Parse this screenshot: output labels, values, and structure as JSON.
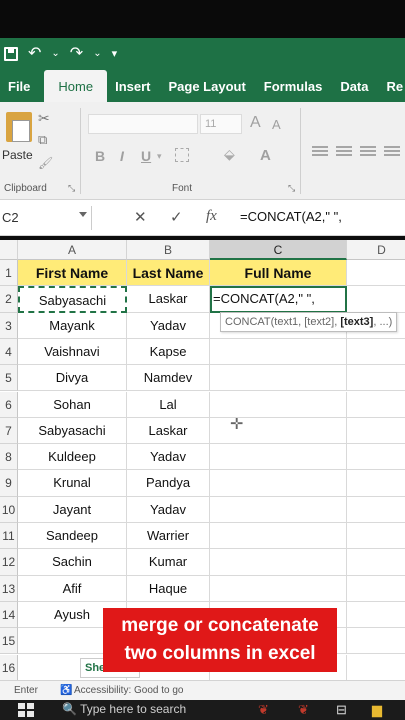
{
  "ribbon": {
    "tabs": [
      "File",
      "Home",
      "Insert",
      "Page Layout",
      "Formulas",
      "Data",
      "Re"
    ],
    "paste_label": "Paste",
    "clipboard_label": "Clipboard",
    "font_label": "Font",
    "font_size": "11",
    "bold": "B",
    "italic": "I",
    "underline": "U",
    "grow_font": "A",
    "shrink_font": "A",
    "font_color": "A"
  },
  "formula_bar": {
    "name_box": "C2",
    "cancel": "✕",
    "enter": "✓",
    "fx": "fx",
    "formula": "=CONCAT(A2,\" \","
  },
  "grid": {
    "columns": [
      "A",
      "B",
      "C",
      "D"
    ],
    "rows": [
      "1",
      "2",
      "3",
      "4",
      "5",
      "6",
      "7",
      "8",
      "9",
      "10",
      "11",
      "12",
      "13",
      "14",
      "15",
      "16"
    ],
    "header": [
      "First Name",
      "Last Name",
      "Full Name"
    ],
    "data": [
      [
        "Sabyasachi",
        "Laskar"
      ],
      [
        "Mayank",
        "Yadav"
      ],
      [
        "Vaishnavi",
        "Kapse"
      ],
      [
        "Divya",
        "Namdev"
      ],
      [
        "Sohan",
        "Lal"
      ],
      [
        "Sabyasachi",
        "Laskar"
      ],
      [
        "Kuldeep",
        "Yadav"
      ],
      [
        "Krunal",
        "Pandya"
      ],
      [
        "Jayant",
        "Yadav"
      ],
      [
        "Sandeep",
        "Warrier"
      ],
      [
        "Sachin",
        "Kumar"
      ],
      [
        "Afif",
        "Haque"
      ],
      [
        "Ayush",
        ""
      ]
    ],
    "active_cell_text": "=CONCAT(A2,\" \",",
    "tooltip_prefix": "CONCAT(text1, [text2], ",
    "tooltip_bold": "[text3]",
    "tooltip_suffix": ", ...)"
  },
  "caption": {
    "line1": "merge or concatenate",
    "line2": "two columns in excel"
  },
  "sheet_tab": "She",
  "status": {
    "mode": "Enter",
    "accessibility": "Accessibility: Good to go"
  },
  "taskbar": {
    "search": "Type here to search"
  },
  "colors": {
    "excel_green": "#1e7145",
    "header_fill": "#ffeb78",
    "caption_bg": "#e01818"
  }
}
